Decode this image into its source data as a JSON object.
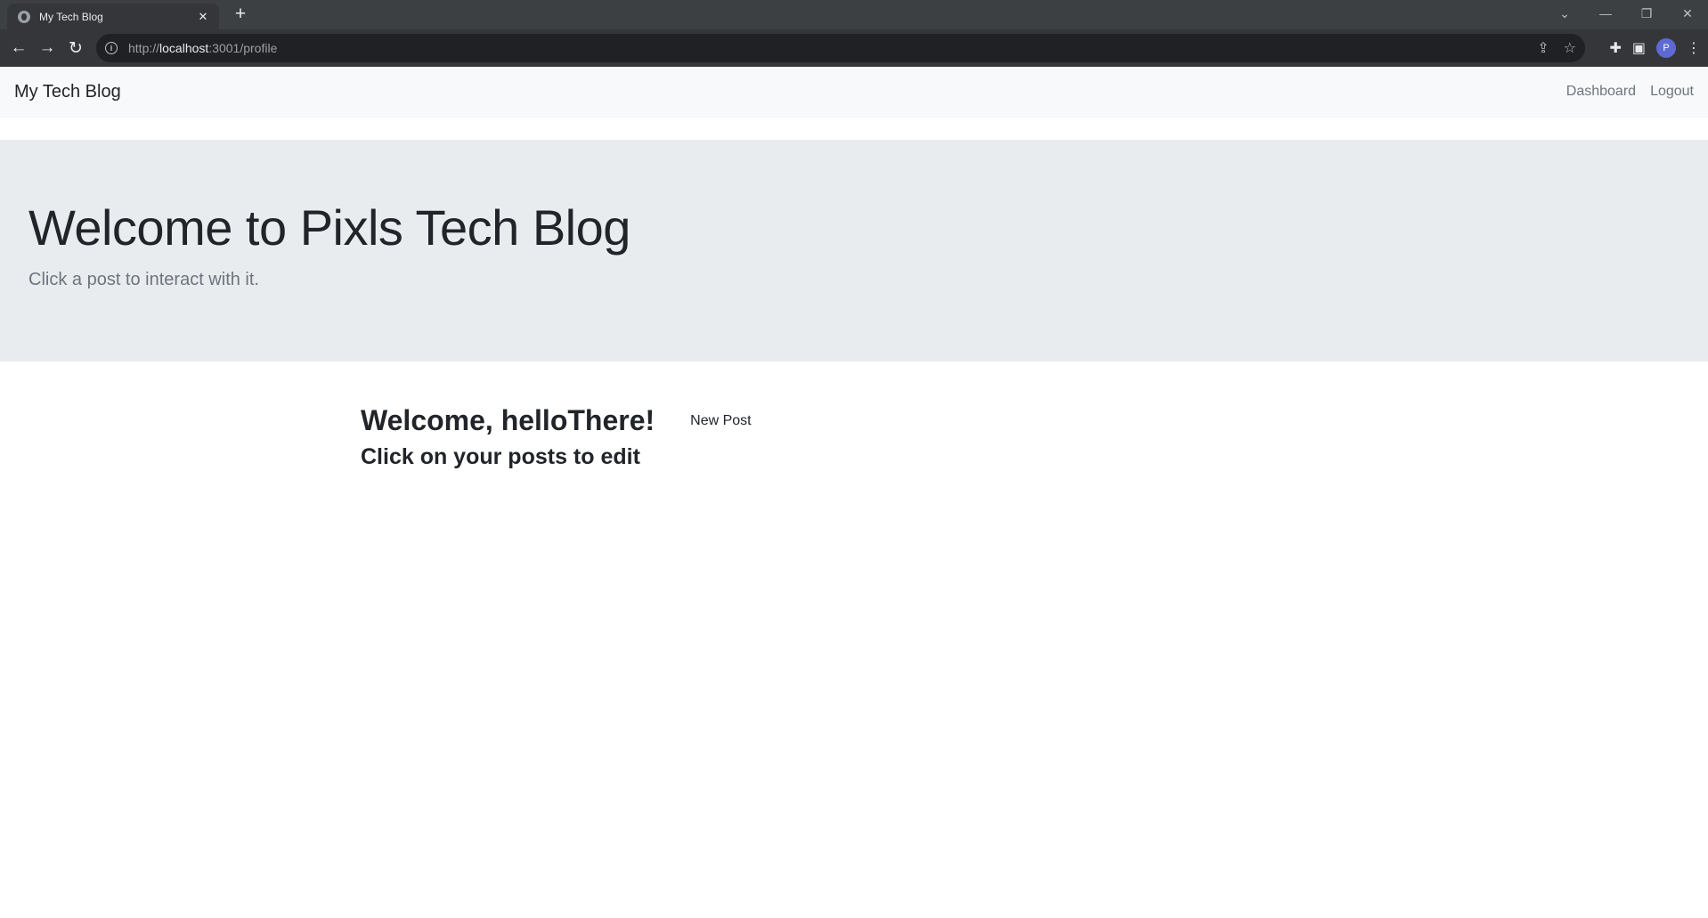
{
  "browser": {
    "tab_title": "My Tech Blog",
    "url_scheme": "http://",
    "url_host": "localhost",
    "url_rest": ":3001/profile",
    "profile_initial": "P"
  },
  "navbar": {
    "brand": "My Tech Blog",
    "links": {
      "dashboard": "Dashboard",
      "logout": "Logout"
    }
  },
  "hero": {
    "title": "Welcome to Pixls Tech Blog",
    "subtitle": "Click a post to interact with it."
  },
  "profile": {
    "welcome": "Welcome, helloThere!",
    "new_post_label": "New Post",
    "edit_hint": "Click on your posts to edit"
  }
}
